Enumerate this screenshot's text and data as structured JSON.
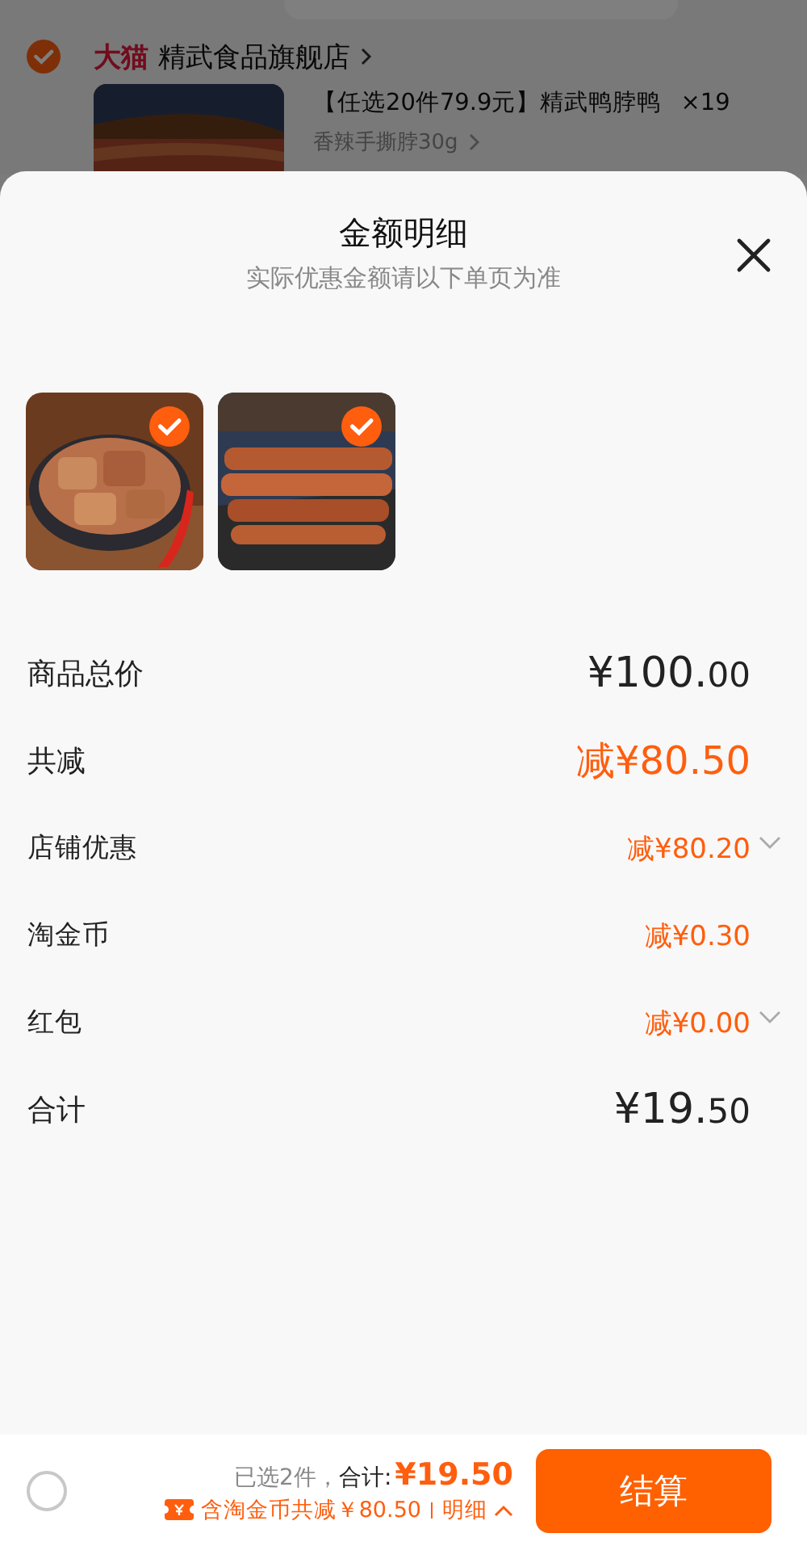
{
  "background": {
    "store": {
      "badge": "大猫",
      "name": "精武食品旗舰店",
      "checked": true
    },
    "item": {
      "title": "【任选20件79.9元】精武鸭脖鸭",
      "quantity": "×19",
      "spec": "香辣手撕脖30g"
    }
  },
  "sheet": {
    "title": "金额明细",
    "subtitle": "实际优惠金额请以下单页为准",
    "products": [
      {
        "kind": "picture",
        "checked": true
      },
      {
        "kind": "picture",
        "checked": true
      }
    ],
    "rows": [
      {
        "label": "商品总价",
        "amount": "¥100.",
        "cents": "00",
        "kind": "total",
        "expandable": false
      },
      {
        "label": "共减",
        "amount": "减¥80.50",
        "kind": "discount",
        "expandable": false
      },
      {
        "label": "店铺优惠",
        "amount": "减¥80.20",
        "kind": "sub",
        "expandable": true
      },
      {
        "label": "淘金币",
        "amount": "减¥0.30",
        "kind": "sub",
        "expandable": false
      },
      {
        "label": "红包",
        "amount": "减¥0.00",
        "kind": "sub",
        "expandable": true
      },
      {
        "label": "合计",
        "amount": "¥19.",
        "cents": "50",
        "kind": "total",
        "expandable": false
      }
    ]
  },
  "footer": {
    "select_all": {
      "checked": false
    },
    "selected": "已选2件，",
    "total_label": "合计:",
    "total": "¥19.50",
    "coin_note": "含淘金币共减￥80.50",
    "detail": "明细",
    "checkout": "结算"
  }
}
